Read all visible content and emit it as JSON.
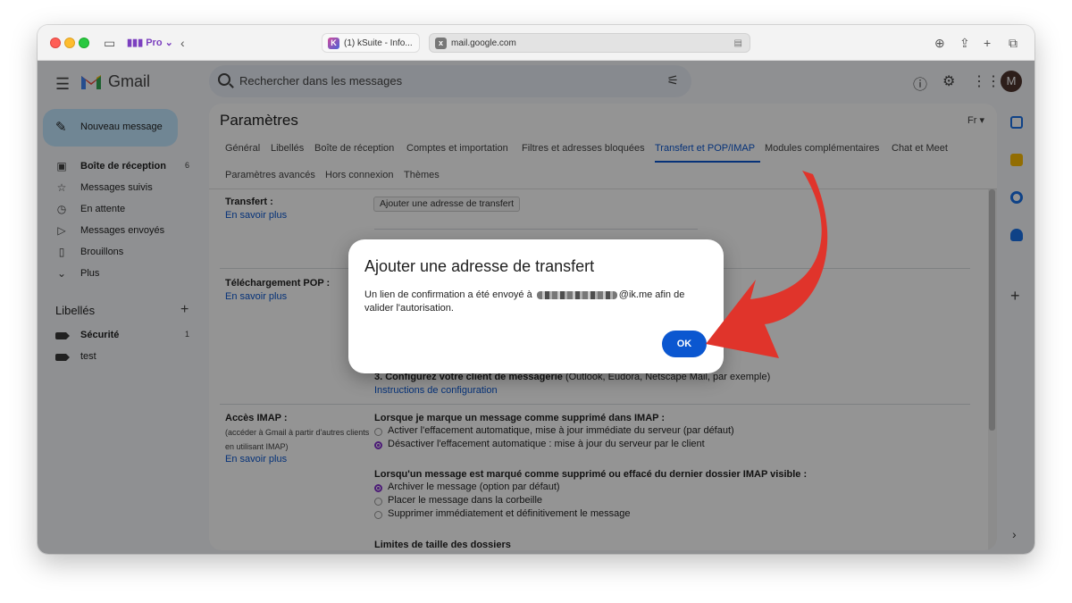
{
  "browser": {
    "profile_label": "Pro",
    "tabs": [
      {
        "title": "(1) kSuite - Info...",
        "favicon": "K"
      },
      {
        "title": "mail.google.com",
        "favicon": "x"
      }
    ]
  },
  "header": {
    "app_name": "Gmail",
    "search_placeholder": "Rechercher dans les messages",
    "avatar_letter": "M"
  },
  "sidebar": {
    "compose_label": "Nouveau message",
    "items": [
      {
        "label": "Boîte de réception",
        "count": "6",
        "icon": "inbox-icon"
      },
      {
        "label": "Messages suivis",
        "icon": "star-icon"
      },
      {
        "label": "En attente",
        "icon": "clock-icon"
      },
      {
        "label": "Messages envoyés",
        "icon": "send-icon"
      },
      {
        "label": "Brouillons",
        "icon": "draft-icon"
      },
      {
        "label": "Plus",
        "icon": "chevron-down-icon"
      }
    ],
    "labels_heading": "Libellés",
    "labels": [
      {
        "label": "Sécurité",
        "count": "1"
      },
      {
        "label": "test"
      }
    ]
  },
  "settings": {
    "title": "Paramètres",
    "input_tools": "Fr",
    "tabs": [
      "Général",
      "Libellés",
      "Boîte de réception",
      "Comptes et importation",
      "Filtres et adresses bloquées",
      "Transfert et POP/IMAP",
      "Modules complémentaires",
      "Chat et Meet",
      "Paramètres avancés",
      "Hors connexion",
      "Thèmes"
    ],
    "active_tab": "Transfert et POP/IMAP",
    "forwarding": {
      "label": "Transfert :",
      "learn_more": "En savoir plus",
      "add_button": "Ajouter une adresse de transfert"
    },
    "pop": {
      "label": "Téléchargement POP :",
      "learn_more": "En savoir plus",
      "step3_bold": "3. Configurez votre client de messagerie",
      "step3_rest": " (Outlook, Eudora, Netscape Mail, par exemple)",
      "step3_link": "Instructions de configuration"
    },
    "imap": {
      "label": "Accès IMAP :",
      "sub1": "(accéder à Gmail à partir d'autres clients",
      "sub2": "en utilisant IMAP)",
      "learn_more": "En savoir plus",
      "q1": "Lorsque je marque un message comme supprimé dans IMAP :",
      "q1_options": [
        "Activer l'effacement automatique, mise à jour immédiate du serveur (par défaut)",
        "Désactiver l'effacement automatique : mise à jour du serveur par le client"
      ],
      "q2": "Lorsqu'un message est marqué comme supprimé ou effacé du dernier dossier IMAP visible :",
      "q2_options": [
        "Archiver le message (option par défaut)",
        "Placer le message dans la corbeille",
        "Supprimer immédiatement et définitivement le message"
      ],
      "q3_cut": "Limites de taille des dossiers"
    }
  },
  "dialog": {
    "title": "Ajouter une adresse de transfert",
    "body_before": "Un lien de confirmation a été envoyé à",
    "body_after": "@ik.me afin de valider l'autorisation.",
    "ok_label": "OK"
  },
  "colors": {
    "accent": "#0b57d0",
    "compose_bg": "#c2e7ff",
    "arrow": "#e0342b",
    "radio_checked": "#8430ce"
  }
}
